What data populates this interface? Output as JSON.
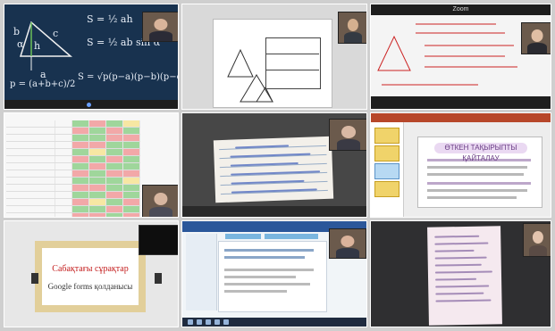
{
  "tiles": {
    "t1": {
      "formulas": [
        "S = ½ ah",
        "S = ½ ab sin α",
        "p = (a+b+c)/2",
        "S = √p(p−a)(p−b)(p−c)"
      ],
      "labels": [
        "a",
        "b",
        "c",
        "h",
        "α"
      ]
    },
    "t3": {
      "top_label": "Zoom"
    },
    "t6": {
      "banner": "ӨТКЕН ТАҚЫРЫПТЫ ҚАЙТАЛАУ"
    },
    "t7": {
      "slide_title": "Сабақтағы сұрақтар",
      "slide_sub": "Google forms қолданысы"
    }
  },
  "colors": {
    "chalkboard": "#18324f",
    "spreadsheet_green": "#9fd69b",
    "spreadsheet_red": "#f2a8a8",
    "slide_title_red": "#c41e1e",
    "banner_purple": "#6a3d85"
  }
}
